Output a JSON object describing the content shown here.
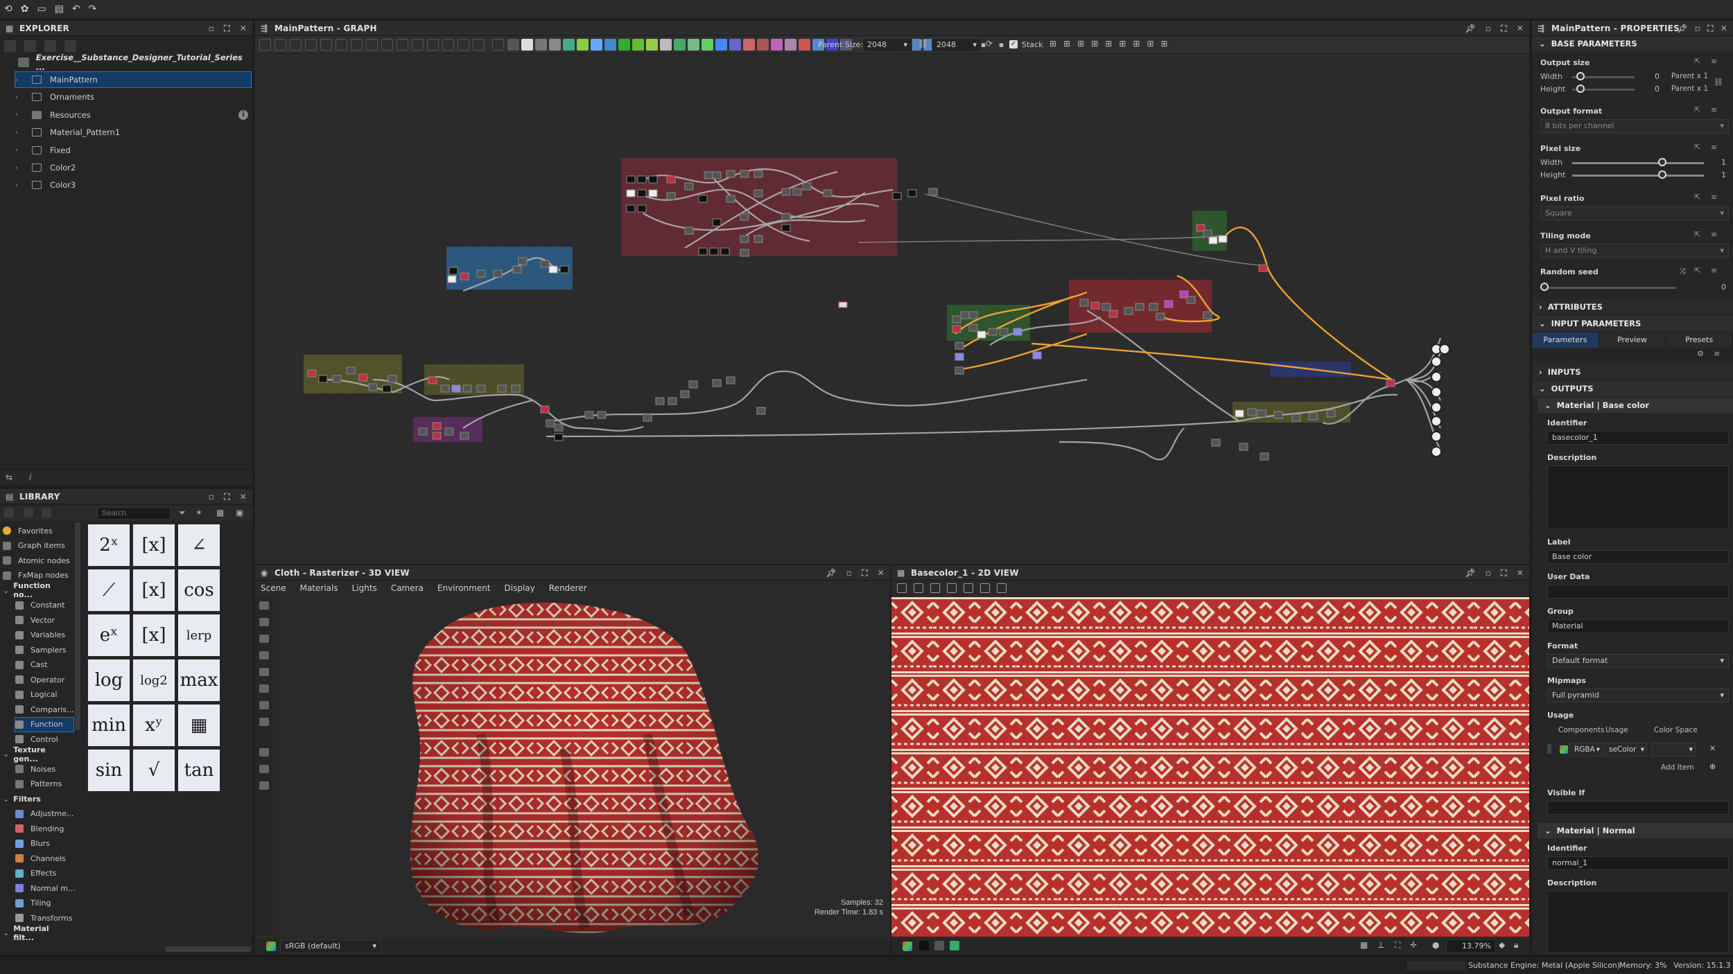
{
  "topbar": {
    "icons": [
      "logo-icon",
      "new-icon",
      "open-icon",
      "save-icon",
      "undo-icon",
      "redo-icon"
    ]
  },
  "explorer": {
    "title": "EXPLORER",
    "package": "Exercise__Substance_Designer_Tutorial_Series ...",
    "items": [
      {
        "label": "MainPattern",
        "type": "graph"
      },
      {
        "label": "Ornaments",
        "type": "graph"
      },
      {
        "label": "Resources",
        "type": "folder"
      },
      {
        "label": "Material_Pattern1",
        "type": "graph"
      },
      {
        "label": "Fixed",
        "type": "graph"
      },
      {
        "label": "Color2",
        "type": "graph"
      },
      {
        "label": "Color3",
        "type": "graph"
      }
    ]
  },
  "library": {
    "title": "LIBRARY",
    "search_placeholder": "Search",
    "categories": [
      {
        "label": "Favorites",
        "indent": 0,
        "color": "#e0b030"
      },
      {
        "label": "Graph items",
        "indent": 0,
        "color": "#777"
      },
      {
        "label": "Atomic nodes",
        "indent": 0,
        "color": "#777"
      },
      {
        "label": "FxMap nodes",
        "indent": 0,
        "color": "#777"
      },
      {
        "label": "Function no...",
        "indent": 0,
        "header": true
      },
      {
        "label": "Constant",
        "indent": 1,
        "color": "#888"
      },
      {
        "label": "Vector",
        "indent": 1,
        "color": "#888"
      },
      {
        "label": "Variables",
        "indent": 1,
        "color": "#888"
      },
      {
        "label": "Samplers",
        "indent": 1,
        "color": "#888"
      },
      {
        "label": "Cast",
        "indent": 1,
        "color": "#888"
      },
      {
        "label": "Operator",
        "indent": 1,
        "color": "#888"
      },
      {
        "label": "Logical",
        "indent": 1,
        "color": "#888"
      },
      {
        "label": "Comparis...",
        "indent": 1,
        "color": "#888"
      },
      {
        "label": "Function",
        "indent": 1,
        "color": "#888",
        "selected": true
      },
      {
        "label": "Control",
        "indent": 1,
        "color": "#888"
      },
      {
        "label": "Texture gen...",
        "indent": 0,
        "header": true
      },
      {
        "label": "Noises",
        "indent": 1,
        "color": "#777"
      },
      {
        "label": "Patterns",
        "indent": 1,
        "color": "#777"
      },
      {
        "label": "Filters",
        "indent": 0,
        "header": true
      },
      {
        "label": "Adjustme...",
        "indent": 1,
        "color": "#6a8fcf"
      },
      {
        "label": "Blending",
        "indent": 1,
        "color": "#d06060"
      },
      {
        "label": "Blurs",
        "indent": 1,
        "color": "#6aa0e0"
      },
      {
        "label": "Channels",
        "indent": 1,
        "color": "#d08040"
      },
      {
        "label": "Effects",
        "indent": 1,
        "color": "#60b0d0"
      },
      {
        "label": "Normal m...",
        "indent": 1,
        "color": "#8080e0"
      },
      {
        "label": "Tiling",
        "indent": 1,
        "color": "#70a0d0"
      },
      {
        "label": "Transforms",
        "indent": 1,
        "color": "#999"
      },
      {
        "label": "Material filt...",
        "indent": 0,
        "header": true
      }
    ],
    "functions": [
      "2ˣ",
      "[x]",
      "∠",
      "⟋",
      "[x]",
      "cos",
      "eˣ",
      "[x]",
      "lerp",
      "log",
      "log2",
      "max",
      "min",
      "xʸ",
      "▦",
      "sin",
      "√",
      "tan"
    ]
  },
  "graph": {
    "title": "MainPattern - GRAPH",
    "parent_size_label": "Parent Size:",
    "parent_size": "2048",
    "size2": "2048",
    "stack_label": "Stack"
  },
  "view3d": {
    "title": "Cloth - Rasterizer - 3D VIEW",
    "menus": [
      "Scene",
      "Materials",
      "Lights",
      "Camera",
      "Environment",
      "Display",
      "Renderer"
    ],
    "samples": "Samples: 32",
    "render_time": "Render Time: 1.83 s",
    "colorspace": "sRGB (default)"
  },
  "view2d": {
    "title": "Basecolor_1 - 2D VIEW",
    "zoom": "13.79%"
  },
  "properties": {
    "title": "MainPattern - PROPERTIES",
    "base_parameters": "BASE PARAMETERS",
    "output_size": "Output size",
    "width_label": "Width",
    "height_label": "Height",
    "width_val": "0",
    "height_val": "0",
    "width_rel": "Parent x 1",
    "height_rel": "Parent x 1",
    "output_format": "Output format",
    "output_format_val": "8 bits per channel",
    "pixel_size": "Pixel size",
    "pixel_w": "1",
    "pixel_h": "1",
    "pixel_ratio": "Pixel ratio",
    "pixel_ratio_val": "Square",
    "tiling_mode": "Tiling mode",
    "tiling_mode_val": "H and V tiling",
    "random_seed": "Random seed",
    "random_seed_val": "0",
    "attributes": "ATTRIBUTES",
    "input_parameters": "INPUT PARAMETERS",
    "tabs": [
      "Parameters",
      "Preview",
      "Presets"
    ],
    "inputs": "INPUTS",
    "outputs": "OUTPUTS",
    "out1": {
      "header": "Material | Base color",
      "identifier_label": "Identifier",
      "identifier": "basecolor_1",
      "description_label": "Description",
      "label_label": "Label",
      "label": "Base color",
      "userdata_label": "User Data",
      "group_label": "Group",
      "group": "Material",
      "format_label": "Format",
      "format": "Default format",
      "mipmaps_label": "Mipmaps",
      "mipmaps": "Full pyramid",
      "usage_label": "Usage",
      "components_label": "Components",
      "usage_col": "Usage",
      "colorspace_col": "Color Space",
      "components": "RGBA",
      "usage": "seColor",
      "add_item": "Add Item",
      "visible_if": "Visible If"
    },
    "out2": {
      "header": "Material | Normal",
      "identifier_label": "Identifier",
      "identifier": "normal_1",
      "description_label": "Description"
    }
  },
  "statusbar": {
    "engine": "Substance Engine: Metal (Apple Silicon)",
    "memory": "Memory: 3%",
    "version": "Version: 15.1.3"
  },
  "colors": {
    "accent": "#2f6fb8",
    "cloth_red": "#b8302c",
    "cloth_cream": "#e9dcc4",
    "wire_orange": "#f0a030"
  }
}
